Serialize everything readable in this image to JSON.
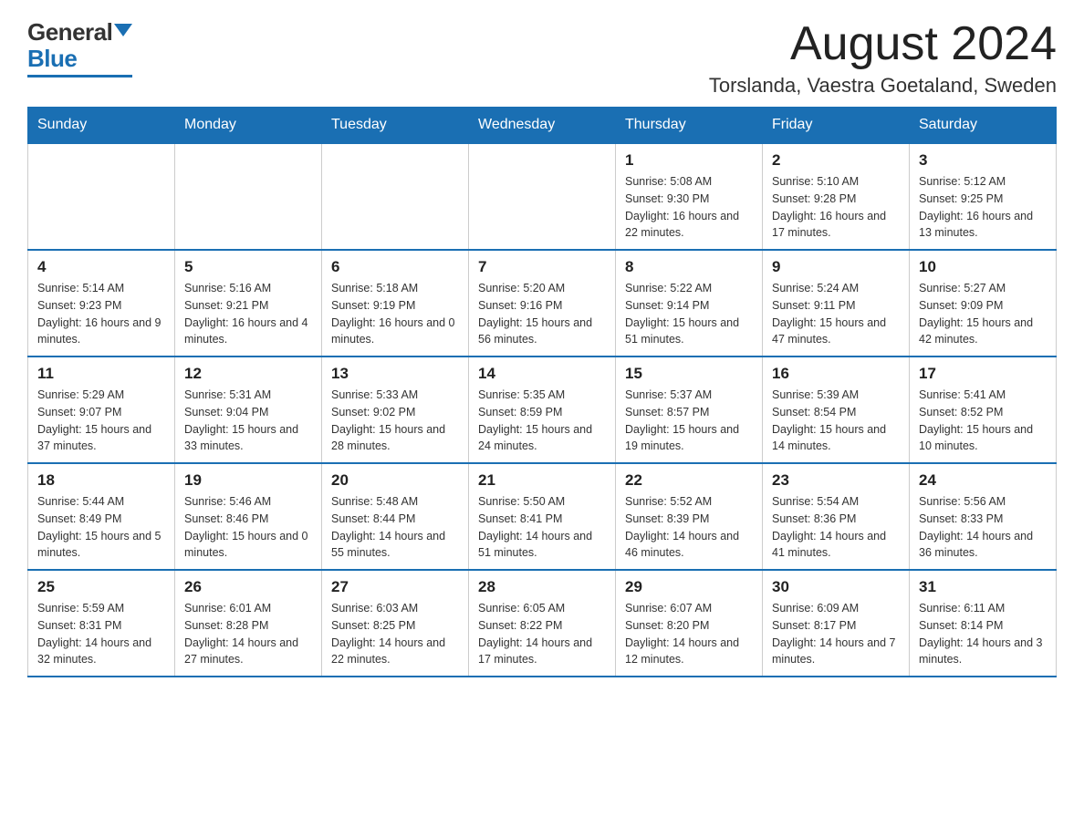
{
  "header": {
    "logo_general": "General",
    "logo_blue": "Blue",
    "month": "August 2024",
    "location": "Torslanda, Vaestra Goetaland, Sweden"
  },
  "days_of_week": [
    "Sunday",
    "Monday",
    "Tuesday",
    "Wednesday",
    "Thursday",
    "Friday",
    "Saturday"
  ],
  "weeks": [
    [
      {
        "day": "",
        "info": ""
      },
      {
        "day": "",
        "info": ""
      },
      {
        "day": "",
        "info": ""
      },
      {
        "day": "",
        "info": ""
      },
      {
        "day": "1",
        "info": "Sunrise: 5:08 AM\nSunset: 9:30 PM\nDaylight: 16 hours and 22 minutes."
      },
      {
        "day": "2",
        "info": "Sunrise: 5:10 AM\nSunset: 9:28 PM\nDaylight: 16 hours and 17 minutes."
      },
      {
        "day": "3",
        "info": "Sunrise: 5:12 AM\nSunset: 9:25 PM\nDaylight: 16 hours and 13 minutes."
      }
    ],
    [
      {
        "day": "4",
        "info": "Sunrise: 5:14 AM\nSunset: 9:23 PM\nDaylight: 16 hours and 9 minutes."
      },
      {
        "day": "5",
        "info": "Sunrise: 5:16 AM\nSunset: 9:21 PM\nDaylight: 16 hours and 4 minutes."
      },
      {
        "day": "6",
        "info": "Sunrise: 5:18 AM\nSunset: 9:19 PM\nDaylight: 16 hours and 0 minutes."
      },
      {
        "day": "7",
        "info": "Sunrise: 5:20 AM\nSunset: 9:16 PM\nDaylight: 15 hours and 56 minutes."
      },
      {
        "day": "8",
        "info": "Sunrise: 5:22 AM\nSunset: 9:14 PM\nDaylight: 15 hours and 51 minutes."
      },
      {
        "day": "9",
        "info": "Sunrise: 5:24 AM\nSunset: 9:11 PM\nDaylight: 15 hours and 47 minutes."
      },
      {
        "day": "10",
        "info": "Sunrise: 5:27 AM\nSunset: 9:09 PM\nDaylight: 15 hours and 42 minutes."
      }
    ],
    [
      {
        "day": "11",
        "info": "Sunrise: 5:29 AM\nSunset: 9:07 PM\nDaylight: 15 hours and 37 minutes."
      },
      {
        "day": "12",
        "info": "Sunrise: 5:31 AM\nSunset: 9:04 PM\nDaylight: 15 hours and 33 minutes."
      },
      {
        "day": "13",
        "info": "Sunrise: 5:33 AM\nSunset: 9:02 PM\nDaylight: 15 hours and 28 minutes."
      },
      {
        "day": "14",
        "info": "Sunrise: 5:35 AM\nSunset: 8:59 PM\nDaylight: 15 hours and 24 minutes."
      },
      {
        "day": "15",
        "info": "Sunrise: 5:37 AM\nSunset: 8:57 PM\nDaylight: 15 hours and 19 minutes."
      },
      {
        "day": "16",
        "info": "Sunrise: 5:39 AM\nSunset: 8:54 PM\nDaylight: 15 hours and 14 minutes."
      },
      {
        "day": "17",
        "info": "Sunrise: 5:41 AM\nSunset: 8:52 PM\nDaylight: 15 hours and 10 minutes."
      }
    ],
    [
      {
        "day": "18",
        "info": "Sunrise: 5:44 AM\nSunset: 8:49 PM\nDaylight: 15 hours and 5 minutes."
      },
      {
        "day": "19",
        "info": "Sunrise: 5:46 AM\nSunset: 8:46 PM\nDaylight: 15 hours and 0 minutes."
      },
      {
        "day": "20",
        "info": "Sunrise: 5:48 AM\nSunset: 8:44 PM\nDaylight: 14 hours and 55 minutes."
      },
      {
        "day": "21",
        "info": "Sunrise: 5:50 AM\nSunset: 8:41 PM\nDaylight: 14 hours and 51 minutes."
      },
      {
        "day": "22",
        "info": "Sunrise: 5:52 AM\nSunset: 8:39 PM\nDaylight: 14 hours and 46 minutes."
      },
      {
        "day": "23",
        "info": "Sunrise: 5:54 AM\nSunset: 8:36 PM\nDaylight: 14 hours and 41 minutes."
      },
      {
        "day": "24",
        "info": "Sunrise: 5:56 AM\nSunset: 8:33 PM\nDaylight: 14 hours and 36 minutes."
      }
    ],
    [
      {
        "day": "25",
        "info": "Sunrise: 5:59 AM\nSunset: 8:31 PM\nDaylight: 14 hours and 32 minutes."
      },
      {
        "day": "26",
        "info": "Sunrise: 6:01 AM\nSunset: 8:28 PM\nDaylight: 14 hours and 27 minutes."
      },
      {
        "day": "27",
        "info": "Sunrise: 6:03 AM\nSunset: 8:25 PM\nDaylight: 14 hours and 22 minutes."
      },
      {
        "day": "28",
        "info": "Sunrise: 6:05 AM\nSunset: 8:22 PM\nDaylight: 14 hours and 17 minutes."
      },
      {
        "day": "29",
        "info": "Sunrise: 6:07 AM\nSunset: 8:20 PM\nDaylight: 14 hours and 12 minutes."
      },
      {
        "day": "30",
        "info": "Sunrise: 6:09 AM\nSunset: 8:17 PM\nDaylight: 14 hours and 7 minutes."
      },
      {
        "day": "31",
        "info": "Sunrise: 6:11 AM\nSunset: 8:14 PM\nDaylight: 14 hours and 3 minutes."
      }
    ]
  ]
}
